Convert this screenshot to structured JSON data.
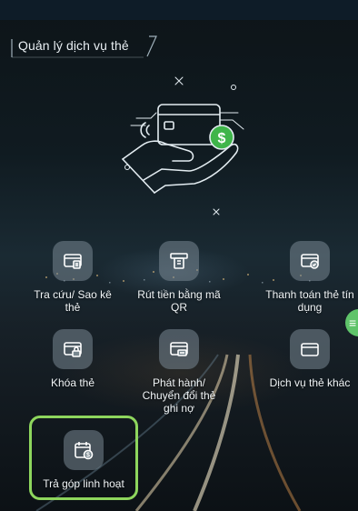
{
  "section": {
    "title": "Quản lý dịch vụ thẻ"
  },
  "services": [
    {
      "label": "Tra cứu/ Sao kê thẻ",
      "icon": "card-statement-icon"
    },
    {
      "label": "Rút tiền bằng mã QR",
      "icon": "atm-qr-icon"
    },
    {
      "label": "Thanh toán thẻ tín dụng",
      "icon": "card-payment-icon"
    },
    {
      "label": "Khóa thẻ",
      "icon": "card-lock-icon"
    },
    {
      "label": "Phát hành/ Chuyển đổi thẻ ghi nợ",
      "icon": "card-issue-icon"
    },
    {
      "label": "Dịch vụ thẻ khác",
      "icon": "card-other-icon"
    },
    {
      "label": "Trả góp linh hoạt",
      "icon": "calendar-dollar-icon"
    }
  ],
  "colors": {
    "accent_green": "#8ed65d",
    "coin_green": "#3fb54a",
    "tile_bg": "#78878f"
  }
}
